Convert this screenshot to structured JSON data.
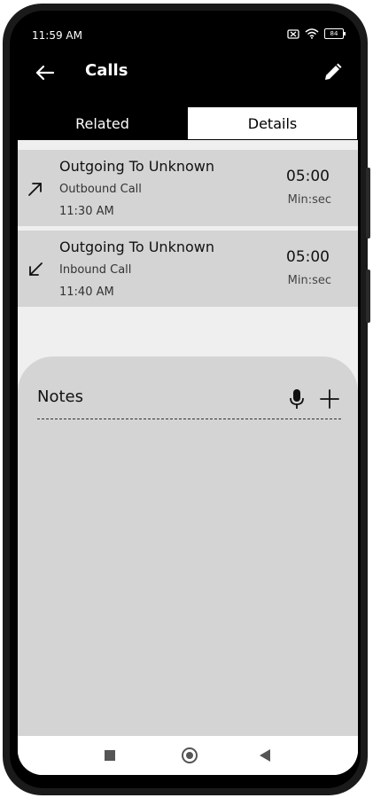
{
  "status": {
    "time": "11:59 AM",
    "battery": "84"
  },
  "appbar": {
    "title": "Calls",
    "back_icon": "arrow-left-icon",
    "edit_icon": "pencil-icon"
  },
  "tabs": [
    {
      "label": "Related",
      "active": true
    },
    {
      "label": "Details",
      "active": false
    }
  ],
  "calls": [
    {
      "title": "Outgoing To Unknown",
      "type": "Outbound Call",
      "time": "11:30 AM",
      "duration": "05:00",
      "unit": "Min:sec",
      "direction_icon": "arrow-up-right-icon"
    },
    {
      "title": "Outgoing To Unknown",
      "type": "Inbound Call",
      "time": "11:40 AM",
      "duration": "05:00",
      "unit": "Min:sec",
      "direction_icon": "arrow-down-left-icon"
    }
  ],
  "notes": {
    "title": "Notes",
    "mic_icon": "microphone-icon",
    "add_icon": "plus-icon"
  },
  "navbar": {
    "icons": [
      "recents-square-icon",
      "home-circle-icon",
      "back-triangle-icon"
    ]
  }
}
